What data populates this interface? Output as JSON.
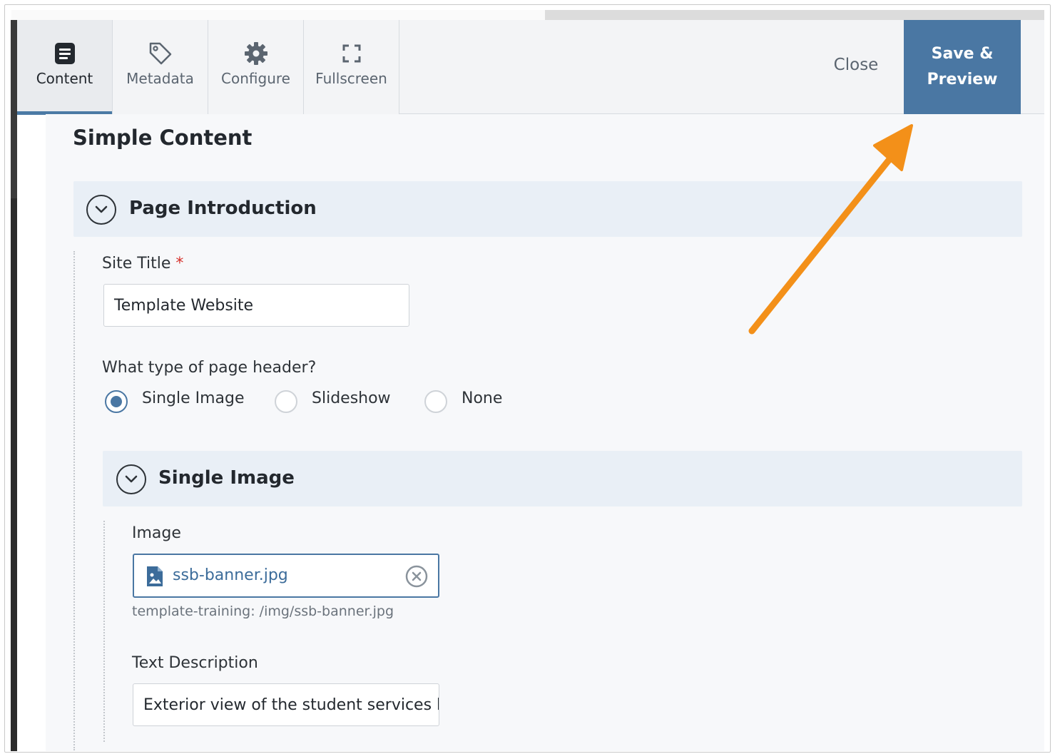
{
  "toolbar": {
    "tabs": [
      {
        "label": "Content",
        "icon": "document-icon",
        "active": true
      },
      {
        "label": "Metadata",
        "icon": "tag-icon",
        "active": false
      },
      {
        "label": "Configure",
        "icon": "gear-icon",
        "active": false
      },
      {
        "label": "Fullscreen",
        "icon": "fullscreen-icon",
        "active": false
      }
    ],
    "close_label": "Close",
    "save_line1": "Save &",
    "save_line2": "Preview"
  },
  "page": {
    "title": "Simple Content"
  },
  "page_introduction": {
    "title": "Page Introduction",
    "site_title_label": "Site Title",
    "required_mark": "*",
    "site_title_value": "Template Website",
    "header_question": "What type of page header?",
    "header_options": [
      "Single Image",
      "Slideshow",
      "None"
    ],
    "header_selected": "Single Image"
  },
  "single_image": {
    "title": "Single Image",
    "image_label": "Image",
    "file_name": "ssb-banner.jpg",
    "file_path": "template-training: /img/ssb-banner.jpg",
    "text_description_label": "Text Description",
    "text_description_value": "Exterior view of the student services b"
  },
  "colors": {
    "accent": "#4a77a3",
    "annotation_arrow": "#f39019",
    "required": "#d6312b"
  }
}
